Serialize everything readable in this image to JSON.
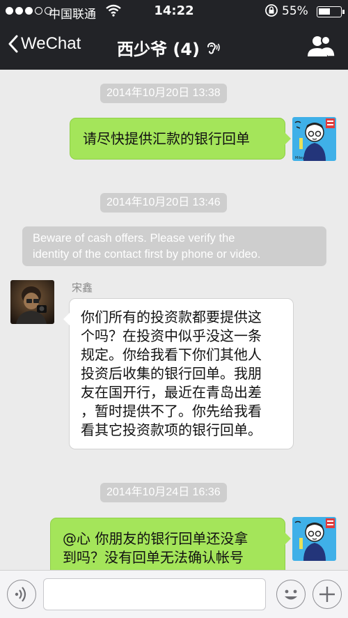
{
  "status_bar": {
    "carrier": "中国联通",
    "time": "14:22",
    "battery_percent": "55%",
    "battery_level": 0.55,
    "signal_bars_filled": 3,
    "signal_bars_total": 5
  },
  "nav": {
    "back_label": "WeChat",
    "chat_title": "西少爷 (4)"
  },
  "messages": {
    "ts1": "2014年10月20日 13:38",
    "msg1": "请尽快提供汇款的银行回单",
    "ts2": "2014年10月20日 13:46",
    "system_notice_line1": "Beware of cash offers. Please verify the",
    "system_notice_line2": "identity of the contact first by phone or video.",
    "sender_name": "宋鑫",
    "msg2_lines": [
      "你们所有的投资款都要提供这",
      "个吗？在投资中似乎没这一条",
      "规定。你给我看下你们其他人",
      "投资后收集的银行回单。我朋",
      "友在国开行，最近在青岛出差",
      "，暂时提供不了。你先给我看",
      "看其它投资款项的银行回单。"
    ],
    "ts3": "2014年10月24日 16:36",
    "msg3_lines": [
      "@心 你朋友的银行回单还没拿",
      "到吗？没有回单无法确认帐号"
    ]
  },
  "colors": {
    "nav_bg": "#222327",
    "chat_bg": "#ebebeb",
    "my_bubble": "#a4e55a",
    "their_bubble": "#ffffff",
    "timestamp_pill": "#cecece"
  },
  "icons": {
    "back": "chevron-left-icon",
    "earpiece": "ear-icon",
    "members": "group-icon",
    "voice": "voice-icon",
    "emoji": "emoji-icon",
    "more": "plus-icon"
  }
}
